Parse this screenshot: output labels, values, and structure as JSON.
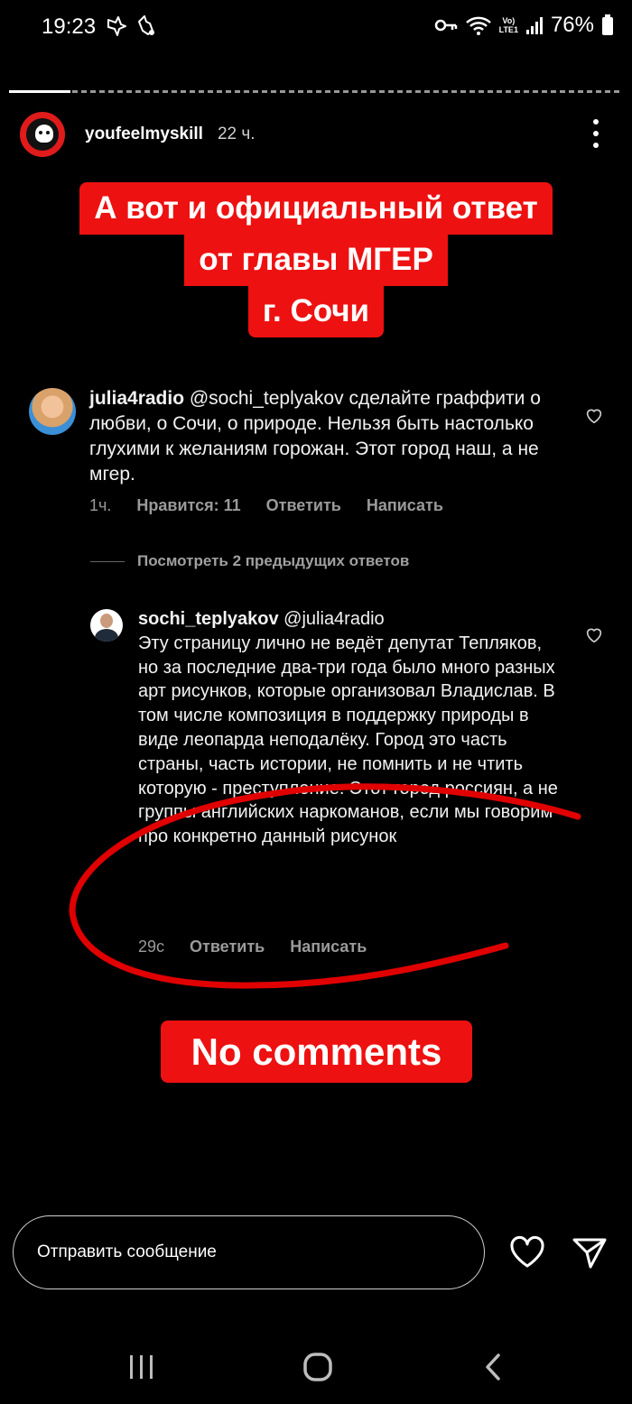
{
  "status_bar": {
    "time": "19:23",
    "battery": "76%",
    "network_label": "LTE1"
  },
  "story": {
    "progress": 0.1,
    "username": "youfeelmyskill",
    "age": "22 ч.",
    "headline_lines": [
      "А вот и официальный ответ",
      "от главы МГЕР",
      "г. Сочи"
    ],
    "footer_caption": "No comments"
  },
  "comment_1": {
    "username": "julia4radio",
    "text": " @sochi_teplyakov сделайте граффити о любви, о Сочи, о природе. Нельзя быть настолько глухими к желаниям горожан. Этот город наш, а не мгер.",
    "time": "1ч.",
    "likes": "Нравится: 11",
    "reply": "Ответить",
    "message": "Написать"
  },
  "view_replies": "Посмотреть 2 предыдущих ответов",
  "comment_2": {
    "username": "sochi_teplyakov",
    "mention": " @julia4radio",
    "text": "Эту страницу лично не ведёт депутат Тепляков, но за последние два-три года было много разных арт рисунков, которые организовал Владислав. В том числе композиция в поддержку природы в виде леопарда неподалёку. Город это часть страны, часть истории, не помнить и не чтить которую - преступление. Этот город россиян, а не группы английских наркоманов, если мы говорим про конкретно данный рисунок",
    "time": "29с",
    "reply": "Ответить",
    "message": "Написать"
  },
  "reply_bar": {
    "placeholder": "Отправить сообщение"
  },
  "colors": {
    "accent_red": "#ee1111",
    "background": "#000000",
    "meta_gray": "#9a9a9a"
  },
  "icons": {
    "status_left": [
      "tiktok-icon",
      "hand-icon"
    ],
    "status_right": [
      "key-icon",
      "wifi-icon",
      "signal-icon",
      "battery-icon"
    ],
    "actions": [
      "heart-icon",
      "send-icon"
    ],
    "nav": [
      "recent-apps-icon",
      "home-icon",
      "back-icon"
    ]
  }
}
